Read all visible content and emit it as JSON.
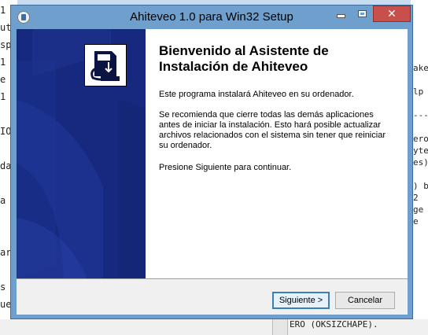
{
  "background": {
    "left_lines": [
      "1",
      "ut",
      "sp",
      " 1",
      "e",
      "1",
      "",
      "IO",
      "",
      "da",
      "",
      " a",
      "",
      "",
      "ar",
      "",
      "s",
      "ue"
    ],
    "right_lines": [
      "ake",
      "",
      "lp",
      "",
      "----",
      "",
      "ero",
      "yte",
      "es)",
      "",
      ") b",
      " 2",
      "ge",
      "e"
    ],
    "bottom_text": "ERO (OKSIZCHAPE)."
  },
  "window": {
    "title": "Ahiteveo 1.0 para Win32 Setup",
    "close_symbol": "✕"
  },
  "wizard": {
    "heading": "Bienvenido al Asistente de Instalación de Ahiteveo",
    "paragraph1": "Este programa instalará Ahiteveo en su ordenador.",
    "paragraph2": "Se recomienda que cierre todas las demás aplicaciones antes de iniciar la instalación. Esto hará posible actualizar archivos relacionados con el sistema sin tener que reiniciar su ordenador.",
    "paragraph3": "Presione Siguiente para continuar."
  },
  "buttons": {
    "next": "Siguiente >",
    "cancel": "Cancelar"
  },
  "colors": {
    "banner": "#16297e",
    "close_button": "#c7504b",
    "frame": "#6fa0cd"
  }
}
